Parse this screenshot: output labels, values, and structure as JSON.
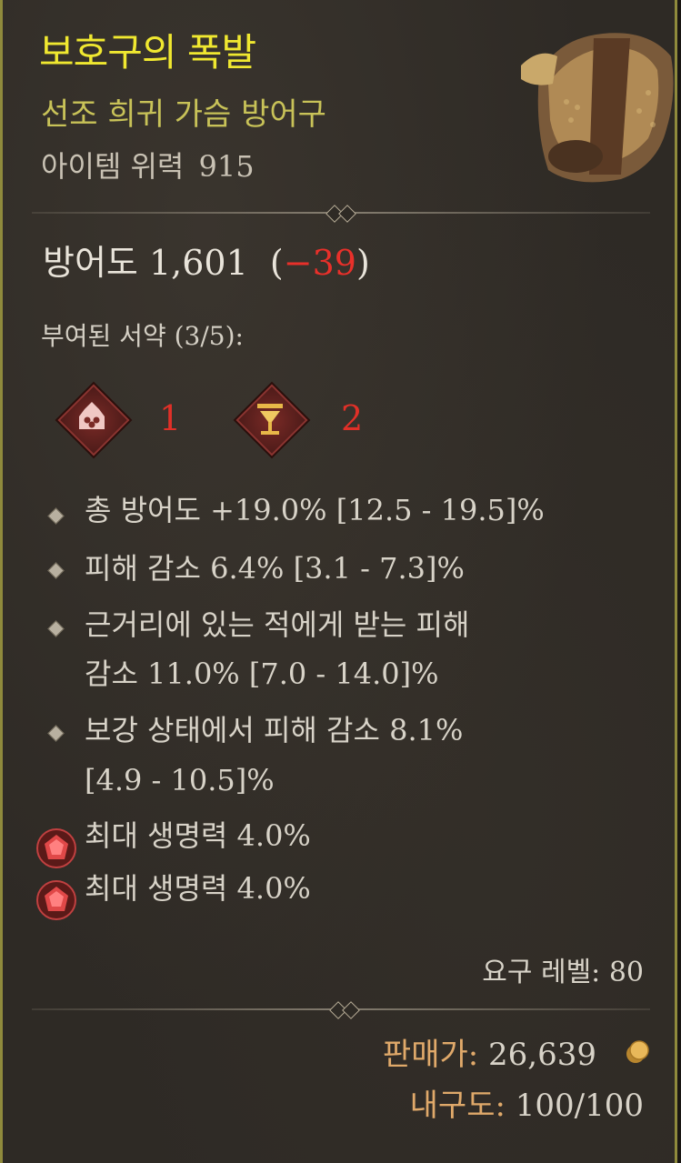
{
  "item": {
    "name": "보호구의 폭발",
    "rarity_type": "선조 희귀 가슴 방어구",
    "power_label": "아이템 위력",
    "power_value": "915",
    "armor_label": "방어도 1,601",
    "armor_diff_open": "(",
    "armor_diff": "−39",
    "armor_diff_close": ")",
    "sigils_label": "부여된 서약 (3/5):",
    "sigils": [
      {
        "icon": "crown-sigil-icon",
        "count": "1"
      },
      {
        "icon": "chalice-sigil-icon",
        "count": "2"
      }
    ],
    "affixes": [
      {
        "lines": [
          "총 방어도 +19.0% [12.5 - 19.5]%"
        ]
      },
      {
        "lines": [
          "피해 감소 6.4% [3.1 - 7.3]%"
        ]
      },
      {
        "lines": [
          "근거리에 있는 적에게 받는 피해",
          "감소 11.0% [7.0 - 14.0]%"
        ]
      },
      {
        "lines": [
          "보강 상태에서 피해 감소 8.1%",
          "[4.9 - 10.5]%"
        ]
      }
    ],
    "socketed_gems": [
      {
        "text": "최대 생명력 4.0%"
      },
      {
        "text": "최대 생명력 4.0%"
      }
    ],
    "requirement": "요구 레벨: 80",
    "sell_label": "판매가:",
    "sell_value": "26,639",
    "durability_label": "내구도:",
    "durability_value": "100/100"
  },
  "colors": {
    "title": "#f0e830",
    "subtitle": "#c8c258",
    "negative": "#e8302a",
    "gold_label": "#e0a96a",
    "border": "#8f8a3c"
  }
}
